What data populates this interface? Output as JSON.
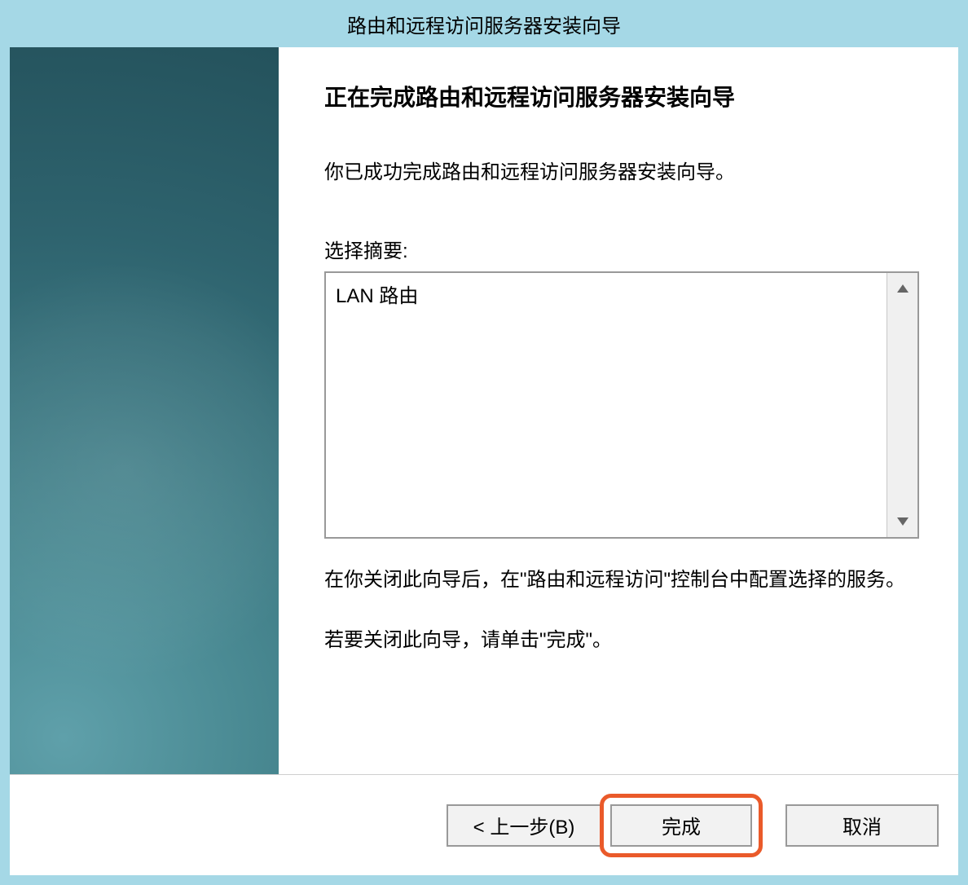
{
  "window": {
    "title": "路由和远程访问服务器安装向导"
  },
  "content": {
    "heading": "正在完成路由和远程访问服务器安装向导",
    "success_message": "你已成功完成路由和远程访问服务器安装向导。",
    "summary_label": "选择摘要:",
    "summary_items": [
      "LAN 路由"
    ],
    "post_text": "在你关闭此向导后，在\"路由和远程访问\"控制台中配置选择的服务。",
    "close_hint": "若要关闭此向导，请单击\"完成\"。"
  },
  "buttons": {
    "back": "< 上一步(B)",
    "finish": "完成",
    "cancel": "取消"
  },
  "highlight": {
    "target": "finish",
    "color": "#ea5a2a"
  }
}
